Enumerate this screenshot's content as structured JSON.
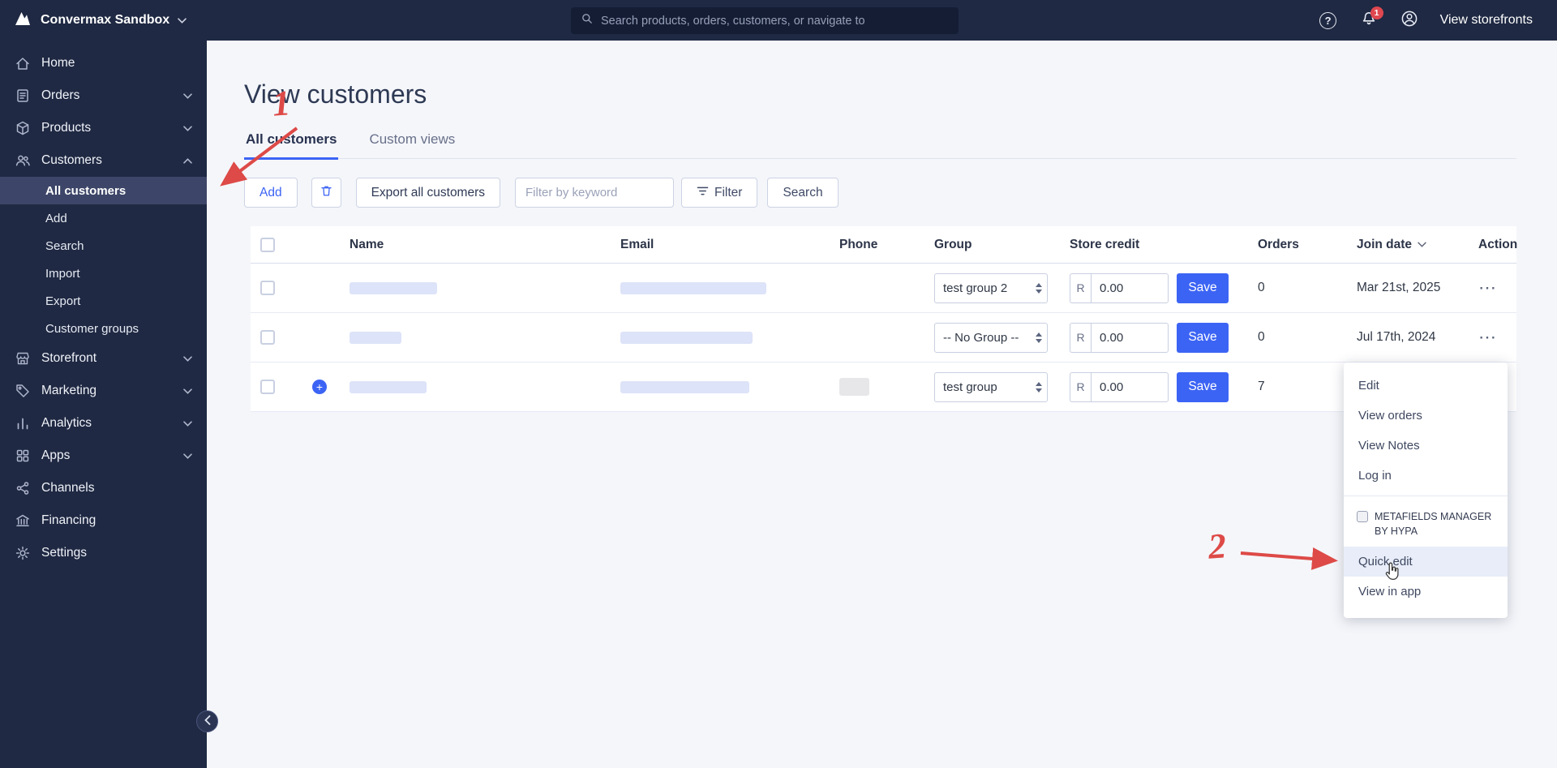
{
  "topbar": {
    "brand": "Convermax Sandbox",
    "search_placeholder": "Search products, orders, customers, or navigate to",
    "notification_count": "1",
    "view_storefronts": "View storefronts"
  },
  "icons": {
    "help_glyph": "?",
    "ellipsis_glyph": "⋯",
    "plus_glyph": "+"
  },
  "sidebar": {
    "items": [
      {
        "label": "Home"
      },
      {
        "label": "Orders"
      },
      {
        "label": "Products"
      },
      {
        "label": "Customers"
      },
      {
        "label": "Storefront"
      },
      {
        "label": "Marketing"
      },
      {
        "label": "Analytics"
      },
      {
        "label": "Apps"
      },
      {
        "label": "Channels"
      },
      {
        "label": "Financing"
      },
      {
        "label": "Settings"
      }
    ],
    "customers_children": [
      {
        "label": "All customers"
      },
      {
        "label": "Add"
      },
      {
        "label": "Search"
      },
      {
        "label": "Import"
      },
      {
        "label": "Export"
      },
      {
        "label": "Customer groups"
      }
    ]
  },
  "page": {
    "title": "View customers",
    "tabs": [
      {
        "label": "All customers"
      },
      {
        "label": "Custom views"
      }
    ],
    "toolbar": {
      "add_label": "Add",
      "export_label": "Export all customers",
      "filter_placeholder": "Filter by keyword",
      "filter_label": "Filter",
      "search_label": "Search"
    }
  },
  "table": {
    "columns": {
      "name": "Name",
      "email": "Email",
      "phone": "Phone",
      "group": "Group",
      "store_credit": "Store credit",
      "orders": "Orders",
      "join_date": "Join date",
      "action": "Action"
    },
    "save_label": "Save",
    "rows": [
      {
        "group": "test group 2",
        "credit_prefix": "R",
        "credit_value": "0.00",
        "orders": "0",
        "join_date": "Mar 21st, 2025"
      },
      {
        "group": "-- No Group --",
        "credit_prefix": "R",
        "credit_value": "0.00",
        "orders": "0",
        "join_date": "Jul 17th, 2024"
      },
      {
        "group": "test group",
        "credit_prefix": "R",
        "credit_value": "0.00",
        "orders": "7",
        "join_date": ""
      }
    ]
  },
  "context_menu": {
    "items": [
      {
        "label": "Edit"
      },
      {
        "label": "View orders"
      },
      {
        "label": "View Notes"
      },
      {
        "label": "Log in"
      }
    ],
    "app_section": {
      "title": "METAFIELDS MANAGER BY HYPA",
      "items": [
        {
          "label": "Quick edit"
        },
        {
          "label": "View in app"
        }
      ]
    }
  },
  "annotations": {
    "step1": "1",
    "step2": "2"
  },
  "colors": {
    "accent": "#3c64f4",
    "navy": "#1f2943",
    "annotation_red": "#dd4a47"
  }
}
